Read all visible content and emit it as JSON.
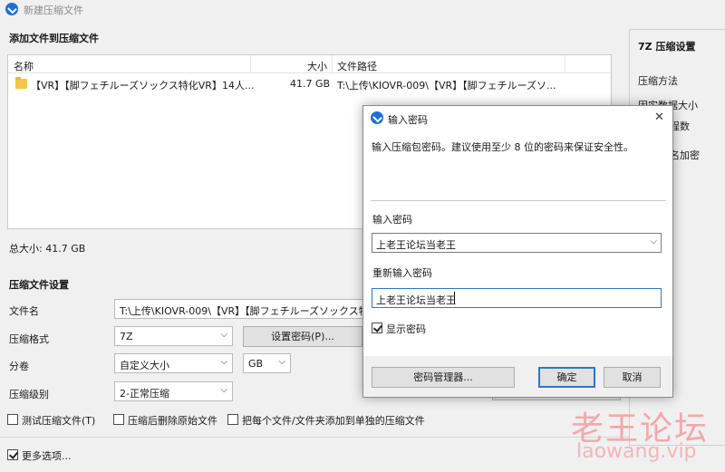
{
  "window": {
    "title": "新建压缩文件"
  },
  "add_section": {
    "title": "添加文件到压缩文件",
    "columns": {
      "name": "名称",
      "size": "大小",
      "path": "文件路径"
    },
    "files": [
      {
        "name": "【VR】【脚フェチルーズソックス特化VR】14人...",
        "size": "41.7 GB",
        "path": "T:\\上传\\KIOVR-009\\【VR】【脚フェチルーズソ..."
      }
    ],
    "total": "总大小: 41.7 GB"
  },
  "settings": {
    "title": "压缩文件设置",
    "filename_label": "文件名",
    "filename_value": "T:\\上传\\KIOVR-009\\【VR】【脚フェチルーズソックス特化",
    "format_label": "压缩格式",
    "format_value": "7Z",
    "set_password_button": "设置密码(P)...",
    "volume_label": "分卷",
    "volume_value": "自定义大小",
    "volume_unit": "GB",
    "level_label": "压缩级别",
    "level_value": "2-正常压缩",
    "test_archive": "测试压缩文件(T)",
    "delete_after": "压缩后删除原始文件",
    "separate": "把每个文件/文件夹添加到单独的压缩文件",
    "more_options": "更多选项..."
  },
  "right_panel": {
    "title": "7Z 压缩设置",
    "items": [
      "压缩方法",
      "固实数据大小",
      "程数",
      "名加密"
    ]
  },
  "dialog": {
    "title": "输入密码",
    "close_glyph": "✕",
    "description": "输入压缩包密码。建议使用至少 8 位的密码来保证安全性。",
    "password_label": "输入密码",
    "password_value": "上老王论坛当老王",
    "confirm_label": "重新输入密码",
    "confirm_value": "上老王论坛当老王",
    "show_password": "显示密码",
    "password_manager_button": "密码管理器...",
    "ok_button": "确定",
    "cancel_button": "取消"
  },
  "watermark": {
    "cn": "老王论坛",
    "url": "laowang.vip"
  },
  "colors": {
    "accent": "#1e6fd6",
    "focus": "#2a78c8",
    "watermark": "#f3a8ad"
  }
}
